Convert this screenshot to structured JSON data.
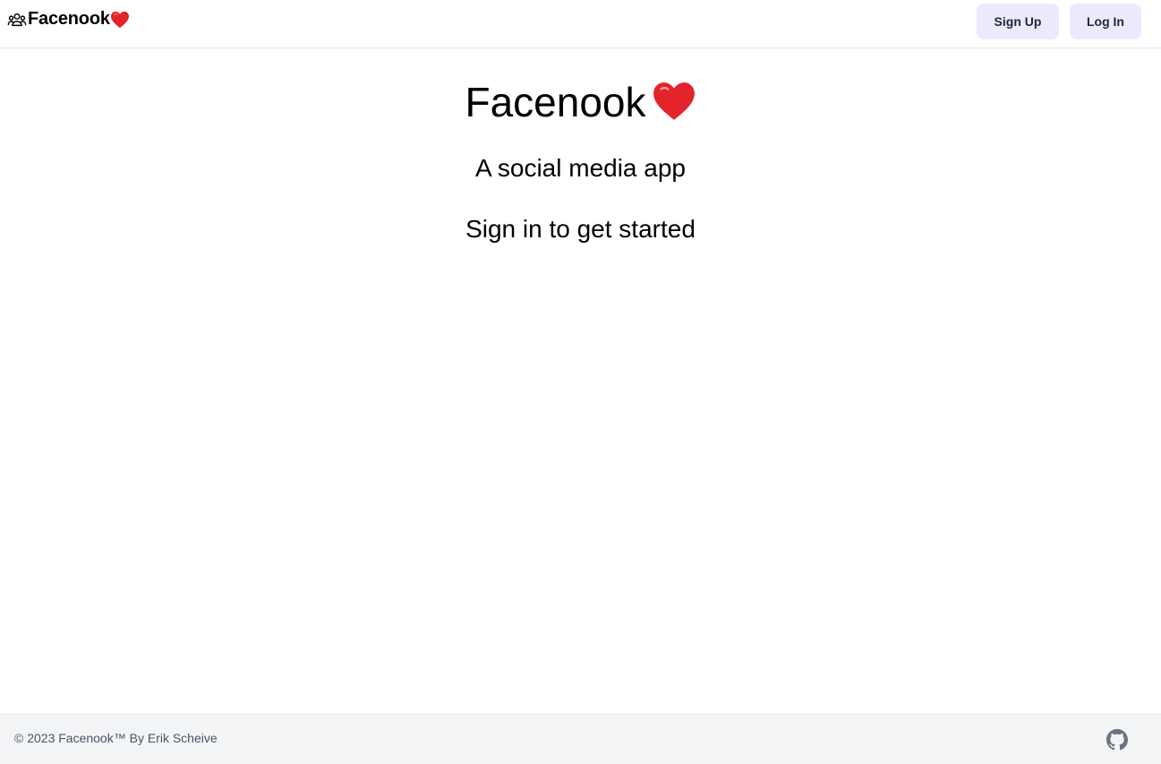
{
  "navbar": {
    "brand_name": "Facenook",
    "brand_icon": "users-icon",
    "heart_icon": "red-heart-emoji",
    "sign_up_label": "Sign Up",
    "log_in_label": "Log In",
    "button_color": "#ede9fe"
  },
  "main": {
    "title": "Facenook",
    "subtitle": "A social media app",
    "cta": "Sign in to get started"
  },
  "footer": {
    "copyright": "© 2023 Facenook™ By",
    "author": "Erik Scheive",
    "github_icon": "github-icon",
    "background": "#f3f4f6"
  }
}
